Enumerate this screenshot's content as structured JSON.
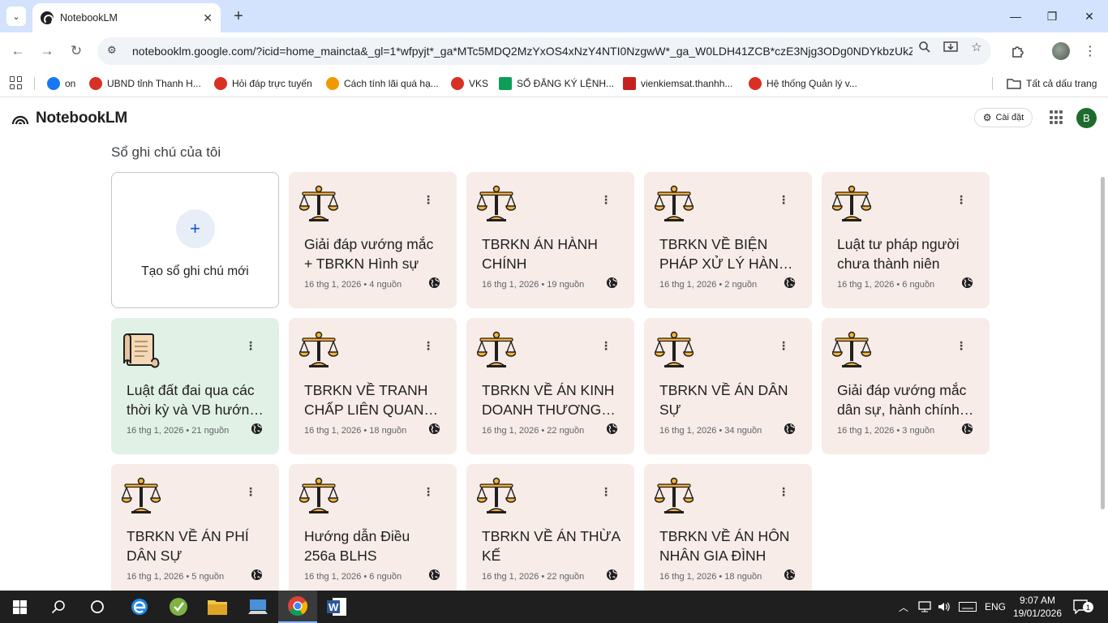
{
  "browser": {
    "tab_title": "NotebookLM",
    "url": "notebooklm.google.com/?icid=home_maincta&_gl=1*wfpyjt*_ga*MTc5MDQ2MzYxOS4xNzY4NTI0NzgwW*_ga_W0LDH41ZCB*czE3Njg3ODg0NDYkbzUkZzA...",
    "bookmarks": [
      {
        "label": "on",
        "color": "#1877f2"
      },
      {
        "label": "UBND tỉnh Thanh H...",
        "color": "#d93025"
      },
      {
        "label": "Hỏi đáp trực tuyến",
        "color": "#d93025"
      },
      {
        "label": "Cách tính lãi quá hạ...",
        "color": "#f29900"
      },
      {
        "label": "VKS",
        "color": "#d93025"
      },
      {
        "label": "SỔ ĐĂNG KÝ LỆNH...",
        "color": "#0f9d58"
      },
      {
        "label": "vienkiemsat.thanhh...",
        "color": "#c5221f"
      },
      {
        "label": "Hệ thống Quản lý v...",
        "color": "#d93025"
      }
    ],
    "all_bookmarks_label": "Tất cả dấu trang"
  },
  "app": {
    "name": "NotebookLM",
    "settings_label": "Cài đặt",
    "avatar_letter": "B"
  },
  "main": {
    "section_title": "Sổ ghi chú của tôi",
    "new_notebook_label": "Tạo sổ ghi chú mới",
    "notebooks": [
      {
        "icon": "scales-icon",
        "title": "Giải đáp vướng mắc + TBRKN Hình sự",
        "meta": "16 thg 1, 2026 • 4 nguồn",
        "theme": "pink"
      },
      {
        "icon": "scales-icon",
        "title": "TBRKN ÁN HÀNH CHÍNH",
        "meta": "16 thg 1, 2026 • 19 nguồn",
        "theme": "pink"
      },
      {
        "icon": "scales-icon",
        "title": "TBRKN VỀ BIỆN PHÁP XỬ LÝ HÀNH CHÍNH",
        "meta": "16 thg 1, 2026 • 2 nguồn",
        "theme": "pink"
      },
      {
        "icon": "scales-icon",
        "title": "Luật tư pháp người chưa thành niên",
        "meta": "16 thg 1, 2026 • 6 nguồn",
        "theme": "pink"
      },
      {
        "icon": "scroll-icon",
        "title": "Luật đất đai qua các thời kỳ và VB hướng dẫn",
        "meta": "16 thg 1, 2026 • 21 nguồn",
        "theme": "green"
      },
      {
        "icon": "scales-icon",
        "title": "TBRKN VỀ TRANH CHẤP LIÊN QUAN ĐẾN",
        "meta": "16 thg 1, 2026 • 18 nguồn",
        "theme": "pink"
      },
      {
        "icon": "scales-icon",
        "title": "TBRKN VỀ ÁN KINH DOANH THƯƠNG MẠI",
        "meta": "16 thg 1, 2026 • 22 nguồn",
        "theme": "pink"
      },
      {
        "icon": "scales-icon",
        "title": "TBRKN VỀ ÁN DÂN SỰ",
        "meta": "16 thg 1, 2026 • 34 nguồn",
        "theme": "pink"
      },
      {
        "icon": "scales-icon",
        "title": "Giải đáp vướng mắc dân sự, hành chính, kinh doanh",
        "meta": "16 thg 1, 2026 • 3 nguồn",
        "theme": "pink"
      },
      {
        "icon": "scales-icon",
        "title": "TBRKN VỀ ÁN PHÍ DÂN SỰ",
        "meta": "16 thg 1, 2026 • 5 nguồn",
        "theme": "pink"
      },
      {
        "icon": "scales-icon",
        "title": "Hướng dẫn Điều 256a BLHS",
        "meta": "16 thg 1, 2026 • 6 nguồn",
        "theme": "pink"
      },
      {
        "icon": "scales-icon",
        "title": "TBRKN VỀ ÁN THỪA KẾ",
        "meta": "16 thg 1, 2026 • 22 nguồn",
        "theme": "pink"
      },
      {
        "icon": "scales-icon",
        "title": "TBRKN VỀ ÁN HÔN NHÂN GIA ĐÌNH",
        "meta": "16 thg 1, 2026 • 18 nguồn",
        "theme": "pink"
      }
    ]
  },
  "taskbar": {
    "language": "ENG",
    "time": "9:07 AM",
    "date": "19/01/2026",
    "notification_count": "1"
  }
}
